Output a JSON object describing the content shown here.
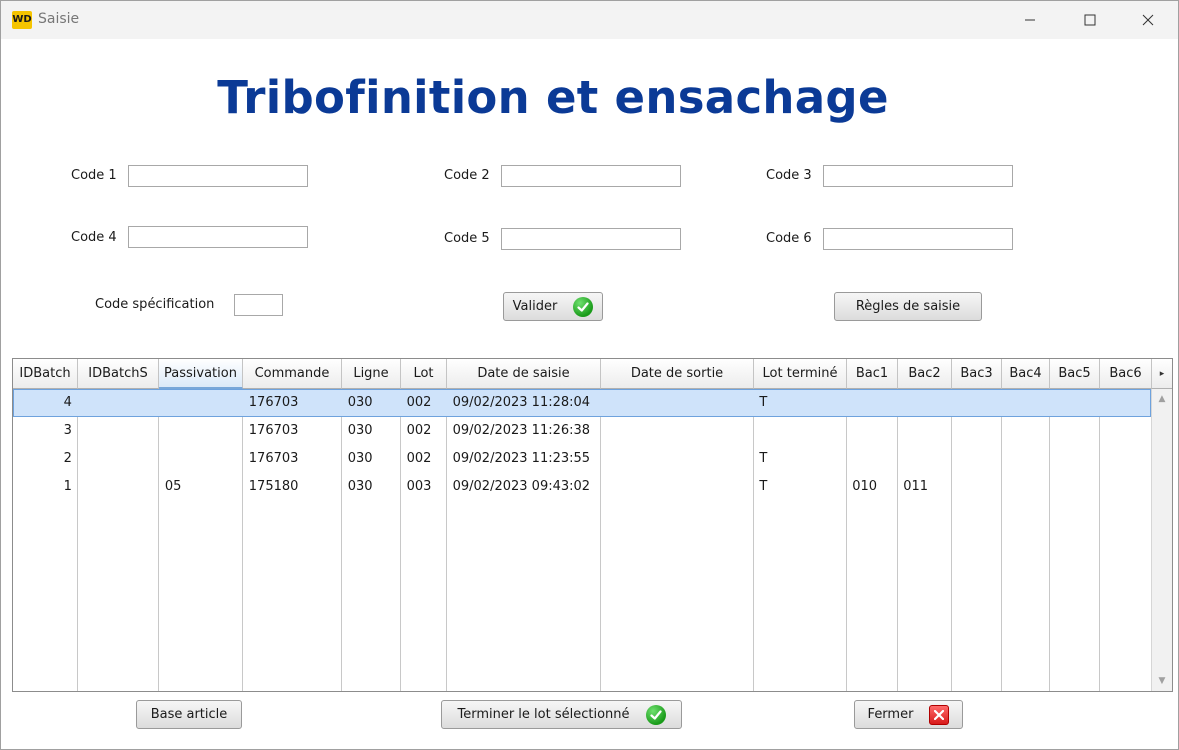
{
  "window": {
    "logo_text": "WD",
    "title": "Saisie"
  },
  "heading": "Tribofinition et ensachage",
  "fields": {
    "code1": {
      "label": "Code 1",
      "value": ""
    },
    "code2": {
      "label": "Code 2",
      "value": ""
    },
    "code3": {
      "label": "Code 3",
      "value": ""
    },
    "code4": {
      "label": "Code 4",
      "value": ""
    },
    "code5": {
      "label": "Code 5",
      "value": ""
    },
    "code6": {
      "label": "Code 6",
      "value": ""
    },
    "code_specification": {
      "label": "Code spécification",
      "value": ""
    }
  },
  "buttons": {
    "valider": "Valider",
    "regles": "Règles de saisie",
    "base_article": "Base article",
    "terminer": "Terminer le lot sélectionné",
    "fermer": "Fermer"
  },
  "table": {
    "columns": [
      "IDBatch",
      "IDBatchS",
      "Passivation",
      "Commande",
      "Ligne",
      "Lot",
      "Date de saisie",
      "Date de sortie",
      "Lot terminé",
      "Bac1",
      "Bac2",
      "Bac3",
      "Bac4",
      "Bac5",
      "Bac6"
    ],
    "sorted_column": "Passivation",
    "selected_row": 0,
    "rows": [
      [
        "4",
        "",
        "",
        "176703",
        "030",
        "002",
        "09/02/2023 11:28:04",
        "",
        "T",
        "",
        "",
        "",
        "",
        "",
        ""
      ],
      [
        "3",
        "",
        "",
        "176703",
        "030",
        "002",
        "09/02/2023 11:26:38",
        "",
        "",
        "",
        "",
        "",
        "",
        "",
        ""
      ],
      [
        "2",
        "",
        "",
        "176703",
        "030",
        "002",
        "09/02/2023 11:23:55",
        "",
        "T",
        "",
        "",
        "",
        "",
        "",
        ""
      ],
      [
        "1",
        "",
        "05",
        "175180",
        "030",
        "003",
        "09/02/2023 09:43:02",
        "",
        "T",
        "010",
        "011",
        "",
        "",
        "",
        ""
      ]
    ]
  },
  "colors": {
    "heading": "#0b3a96",
    "selected_row": "#cfe3fa",
    "ok_green": "#1a9b1a",
    "close_red": "#d81b1b"
  }
}
